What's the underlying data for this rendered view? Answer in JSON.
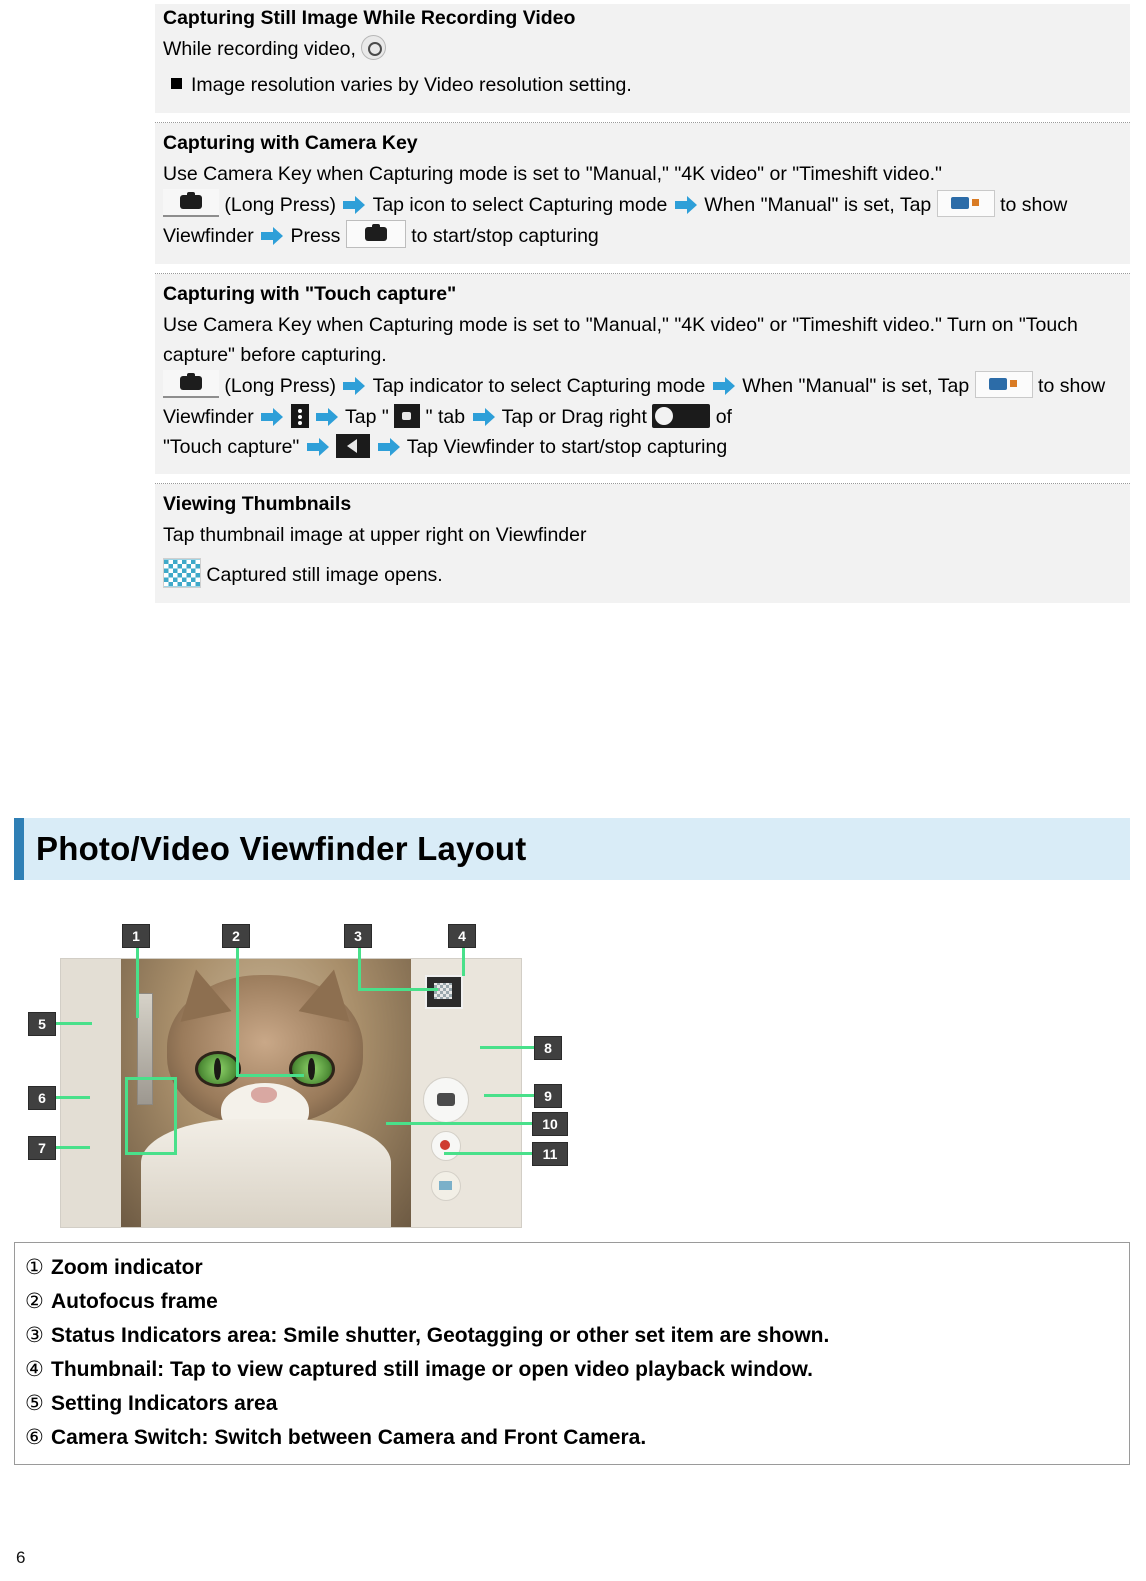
{
  "document": {
    "page_number": "6"
  },
  "sections": [
    {
      "title": "Capturing Still Image While Recording Video",
      "body_pre": "While recording video,",
      "icons": [
        "video-record-icon"
      ],
      "bullet": "Image resolution varies by Video resolution setting."
    },
    {
      "title": "Capturing with Camera Key",
      "line1": "Use Camera Key when Capturing mode is set to \"Manual,\" \"4K video\" or \"Timeshift video.\"",
      "steps": [
        "(Long Press)",
        "Tap icon to select Capturing mode",
        "When \"Manual\" is set, Tap",
        "to show Viewfinder",
        "Press",
        "to start/stop capturing"
      ]
    },
    {
      "title": "Capturing with \"Touch capture\"",
      "line1": "Use Camera Key when Capturing mode is set to \"Manual,\" \"4K video\" or \"Timeshift video.\" Turn on \"Touch capture\" before capturing.",
      "steps": [
        "(Long Press)",
        "Tap indicator to select Capturing mode",
        "When \"Manual\" is set, Tap",
        "to show Viewfinder",
        "Tap \"",
        "\" tab",
        "Tap or Drag right",
        "of",
        "\"Touch capture\"",
        "Tap Viewfinder to start/stop capturing"
      ]
    },
    {
      "title": "Viewing Thumbnails",
      "line1": "Tap thumbnail image at upper right on Viewfinder",
      "line2": "Captured still image opens."
    }
  ],
  "chapter": {
    "title": "Photo/Video Viewfinder Layout",
    "accent_color": "#2f7fb5",
    "background_color": "#d9ecf7"
  },
  "figure": {
    "callouts": [
      "1",
      "2",
      "3",
      "4",
      "5",
      "6",
      "7",
      "8",
      "9",
      "10",
      "11"
    ],
    "guide_color": "#49e08a"
  },
  "legend": [
    {
      "num": "①",
      "text": "Zoom indicator"
    },
    {
      "num": "②",
      "text": "Autofocus frame"
    },
    {
      "num": "③",
      "text": "Status Indicators area: Smile shutter, Geotagging or other set item are shown."
    },
    {
      "num": "④",
      "text": "Thumbnail: Tap to view captured still image or open video playback window."
    },
    {
      "num": "⑤",
      "text": "Setting Indicators area"
    },
    {
      "num": "⑥",
      "text": "Camera Switch: Switch between Camera and Front Camera."
    }
  ]
}
